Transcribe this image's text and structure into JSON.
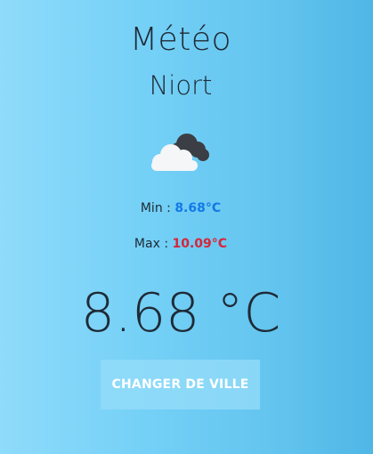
{
  "header": {
    "title": "Météo",
    "city": "Niort"
  },
  "weather": {
    "icon": "cloudy-icon",
    "min_label": "Min :",
    "min_value": "8.68°C",
    "max_label": "Max :",
    "max_value": "10.09°C",
    "current": "8.68 °C"
  },
  "actions": {
    "change_city_label": "CHANGER DE VILLE"
  },
  "colors": {
    "min_value": "#1479e6",
    "max_value": "#d6263a",
    "text": "#1f2a36"
  }
}
